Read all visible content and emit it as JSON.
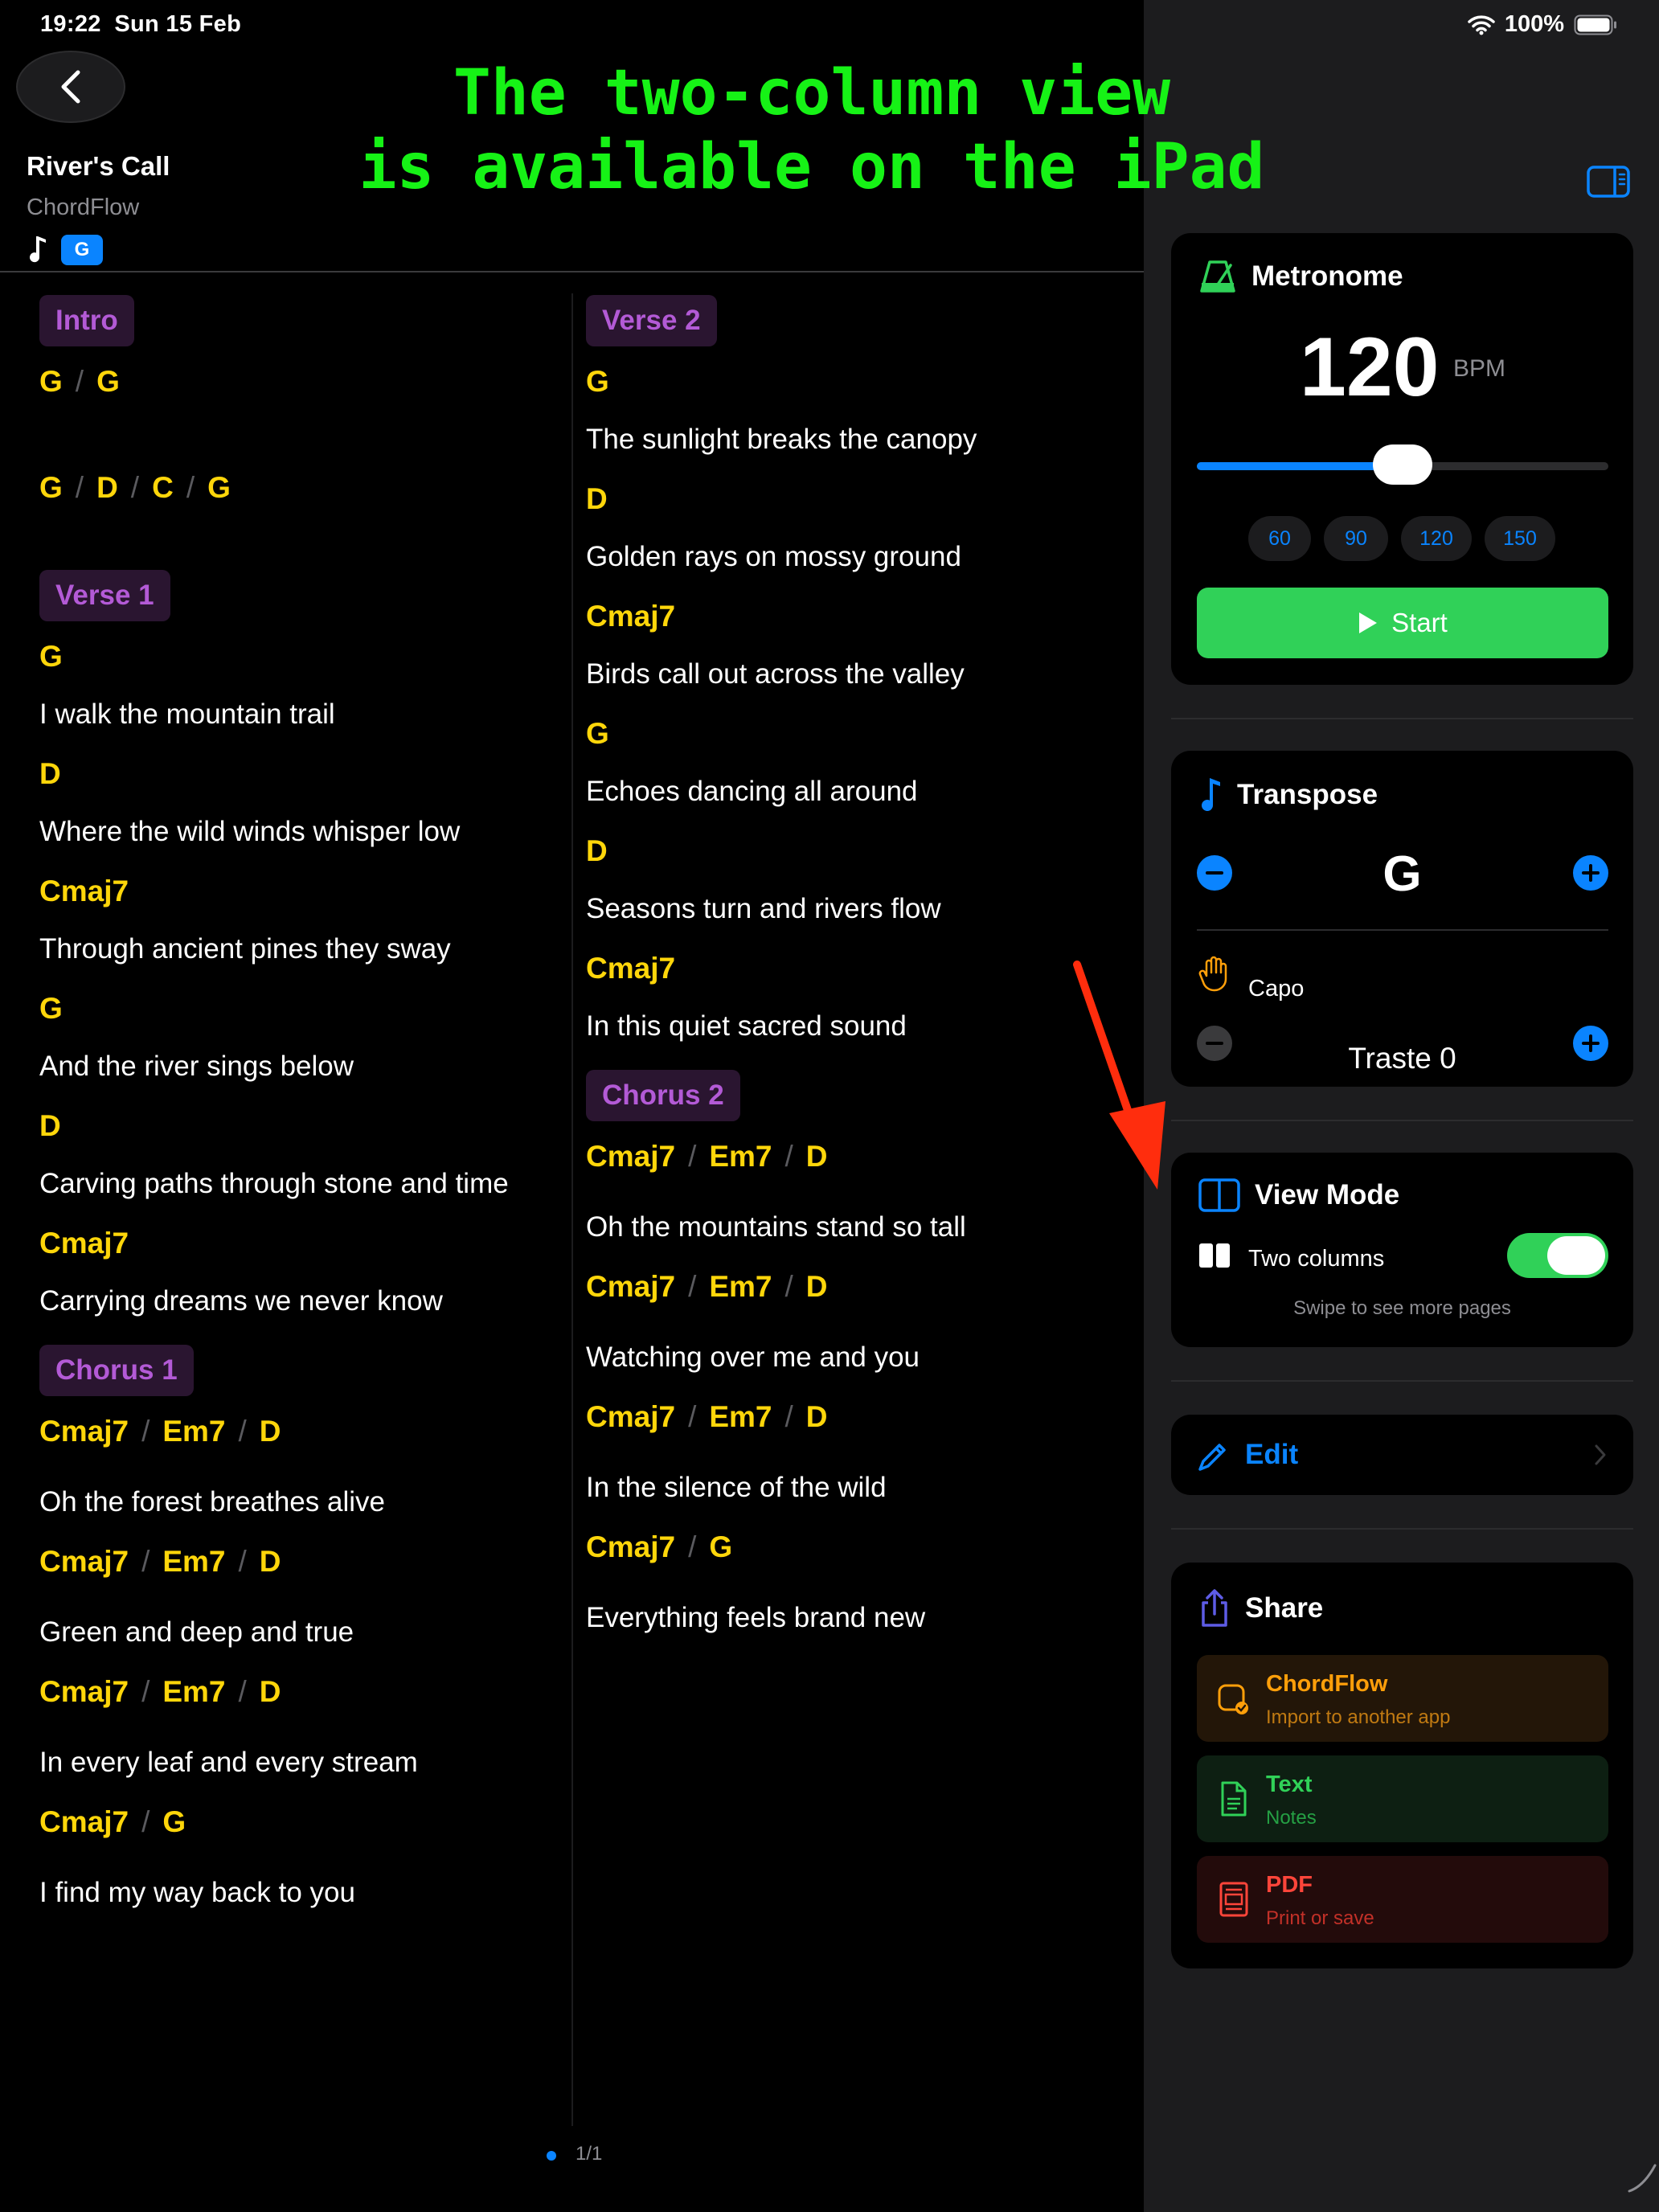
{
  "status_bar": {
    "time": "19:22",
    "date": "Sun 15 Feb",
    "battery": "100%"
  },
  "caption": {
    "line1": "The two-column view",
    "line2": "is available on the iPad"
  },
  "song": {
    "title": "River's Call",
    "artist": "ChordFlow",
    "key": "G"
  },
  "column_1": {
    "intro_label": "Intro",
    "intro_chords_1": [
      "G",
      "G"
    ],
    "intro_chords_2": [
      "G",
      "D",
      "C",
      "G"
    ],
    "verse1_label": "Verse 1",
    "verse1_lines": [
      [
        "G",
        "I walk the mountain trail"
      ],
      [
        "D",
        "Where the wild winds whisper low"
      ],
      [
        "Cmaj7",
        "Through ancient pines they sway"
      ],
      [
        "G",
        "And the river sings below"
      ],
      [
        "D",
        "Carving paths through stone and time"
      ],
      [
        "Cmaj7",
        "Carrying dreams we never know"
      ]
    ],
    "chorus1_label": "Chorus 1",
    "chorus1_blocks": [
      {
        "chords": [
          "Cmaj7",
          "Em7",
          "D"
        ],
        "lyric": "Oh the forest breathes alive"
      },
      {
        "chords": [
          "Cmaj7",
          "Em7",
          "D"
        ],
        "lyric": "Green and deep and true"
      },
      {
        "chords": [
          "Cmaj7",
          "Em7",
          "D"
        ],
        "lyric": "In every leaf and every stream"
      },
      {
        "chords": [
          "Cmaj7",
          "G"
        ],
        "lyric": "I find my way back to you"
      }
    ]
  },
  "column_2": {
    "verse2_label": "Verse 2",
    "verse2_lines": [
      [
        "G",
        "The sunlight breaks the canopy"
      ],
      [
        "D",
        "Golden rays on mossy ground"
      ],
      [
        "Cmaj7",
        "Birds call out across the valley"
      ],
      [
        "G",
        "Echoes dancing all around"
      ],
      [
        "D",
        "Seasons turn and rivers flow"
      ],
      [
        "Cmaj7",
        "In this quiet sacred sound"
      ]
    ],
    "chorus2_label": "Chorus 2",
    "chorus2_blocks": [
      {
        "chords": [
          "Cmaj7",
          "Em7",
          "D"
        ],
        "lyric": "Oh the mountains stand so tall"
      },
      {
        "chords": [
          "Cmaj7",
          "Em7",
          "D"
        ],
        "lyric": "Watching over me and you"
      },
      {
        "chords": [
          "Cmaj7",
          "Em7",
          "D"
        ],
        "lyric": "In the silence of the wild"
      },
      {
        "chords": [
          "Cmaj7",
          "G"
        ],
        "lyric": "Everything feels brand new"
      }
    ]
  },
  "pagination": {
    "label": "1/1"
  },
  "metronome": {
    "title": "Metronome",
    "bpm": "120",
    "unit": "BPM",
    "slider_fraction": 0.5,
    "presets": [
      "60",
      "90",
      "120",
      "150"
    ],
    "start_label": "Start"
  },
  "transpose": {
    "title": "Transpose",
    "key": "G",
    "capo_label": "Capo",
    "capo_value": "Traste 0"
  },
  "view_mode": {
    "title": "View Mode",
    "two_columns_label": "Two columns",
    "enabled": true,
    "hint": "Swipe to see more pages"
  },
  "edit": {
    "label": "Edit"
  },
  "share": {
    "title": "Share",
    "options": [
      {
        "title": "ChordFlow",
        "subtitle": "Import to another app",
        "color": "#ff9f0a",
        "bg": "#231608"
      },
      {
        "title": "Text",
        "subtitle": "Notes",
        "color": "#30d158",
        "bg": "#0d1f12"
      },
      {
        "title": "PDF",
        "subtitle": "Print or save",
        "color": "#ff453a",
        "bg": "#230b0b"
      }
    ]
  },
  "colors": {
    "accent": "#0a84ff",
    "chord": "#ffd60a",
    "section": "#b35ad6",
    "green": "#30d158",
    "caption": "#16f216",
    "arrow": "#ff2d0d"
  }
}
